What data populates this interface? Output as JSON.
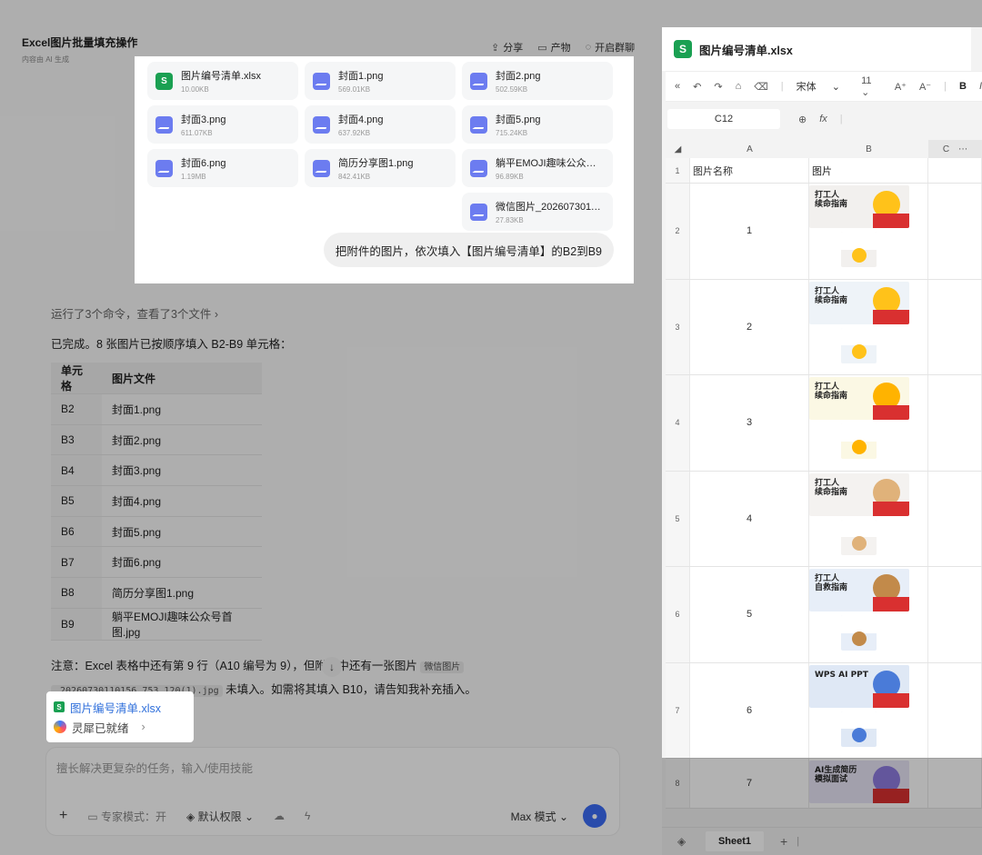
{
  "app": {
    "title": "Excel图片批量填充操作",
    "subtitle": "内容由 AI 生成",
    "actions": [
      "分享",
      "产物",
      "开启群聊"
    ]
  },
  "message": {
    "files": [
      {
        "name": "图片编号清单.xlsx",
        "size": "10.00KB",
        "type": "xls"
      },
      {
        "name": "封面1.png",
        "size": "569.01KB",
        "type": "img"
      },
      {
        "name": "封面2.png",
        "size": "502.59KB",
        "type": "img"
      },
      {
        "name": "封面3.png",
        "size": "611.07KB",
        "type": "img"
      },
      {
        "name": "封面4.png",
        "size": "637.92KB",
        "type": "img"
      },
      {
        "name": "封面5.png",
        "size": "715.24KB",
        "type": "img"
      },
      {
        "name": "封面6.png",
        "size": "1.19MB",
        "type": "img"
      },
      {
        "name": "简历分享图1.png",
        "size": "842.41KB",
        "type": "img"
      },
      {
        "name": "躺平EMOJI趣味公众号…",
        "size": "96.89KB",
        "type": "img"
      },
      {
        "name": "微信图片_2026073011…",
        "size": "27.83KB",
        "type": "img"
      }
    ],
    "prompt": "把附件的图片，依次填入【图片编号清单】的B2到B9"
  },
  "reply": {
    "ran": "运行了3个命令，查看了3个文件",
    "ran_chevron": "›",
    "done": "已完成。8 张图片已按顺序填入 B2-B9 单元格：",
    "table_headers": [
      "单元格",
      "图片文件"
    ],
    "table_rows": [
      [
        "B2",
        "封面1.png"
      ],
      [
        "B3",
        "封面2.png"
      ],
      [
        "B4",
        "封面3.png"
      ],
      [
        "B5",
        "封面4.png"
      ],
      [
        "B6",
        "封面5.png"
      ],
      [
        "B7",
        "封面6.png"
      ],
      [
        "B8",
        "简历分享图1.png"
      ],
      [
        "B9",
        "躺平EMOJI趣味公众号首图.jpg"
      ]
    ],
    "note_part1": "注意：Excel 表格中还有第 9 行（A10 编号为 9），但附件中还有一张图片",
    "note_code1": "微信图片",
    "note_code2": "_20260730110156_753_120(1).jpg",
    "note_part2": "未填入。如需将其填入 B10，请告知我补充插入。",
    "attachment": "图片编号清单.xlsx",
    "status": "灵犀已就绪",
    "status_chevron": "›"
  },
  "input": {
    "placeholder": "擅长解决更复杂的任务，输入/使用技能",
    "expert_mode": "专家模式：开",
    "permission": "默认权限",
    "model": "Max 模式"
  },
  "sheet": {
    "title": "图片编号清单.xlsx",
    "font": "宋体",
    "font_size": "11",
    "cell_ref": "C12",
    "columns": [
      "A",
      "B",
      "C"
    ],
    "header_row": {
      "num": "1",
      "a": "图片名称",
      "b": "图片"
    },
    "rows": [
      {
        "num": "2",
        "a": "1",
        "text": "打工人\n续命指南",
        "bg": "#f2f0ee",
        "emoji": "#ffc21a"
      },
      {
        "num": "3",
        "a": "2",
        "text": "打工人\n续命指南",
        "bg": "#eef3f8",
        "emoji": "#ffc21a"
      },
      {
        "num": "4",
        "a": "3",
        "text": "打工人\n续命指南",
        "bg": "#fbf8e4",
        "emoji": "#ffb300"
      },
      {
        "num": "5",
        "a": "4",
        "text": "打工人\n续命指南",
        "bg": "#f4f2f0",
        "emoji": "#e0b27a"
      },
      {
        "num": "6",
        "a": "5",
        "text": "打工人\n自救指南",
        "bg": "#e7eef8",
        "emoji": "#c28a4a"
      },
      {
        "num": "7",
        "a": "6",
        "text": "WPS AI PPT",
        "bg": "#dfe8f5",
        "emoji": "#4a7bd8"
      },
      {
        "num": "8",
        "a": "7",
        "text": "AI生成简历\n模拟面试",
        "bg": "#e9e6f6",
        "emoji": "#8f7be0"
      }
    ],
    "sheet_tab": "Sheet1"
  },
  "colors": {
    "accent": "#3b6cf5",
    "excel": "#1aa052",
    "image": "#6c7cf0"
  }
}
